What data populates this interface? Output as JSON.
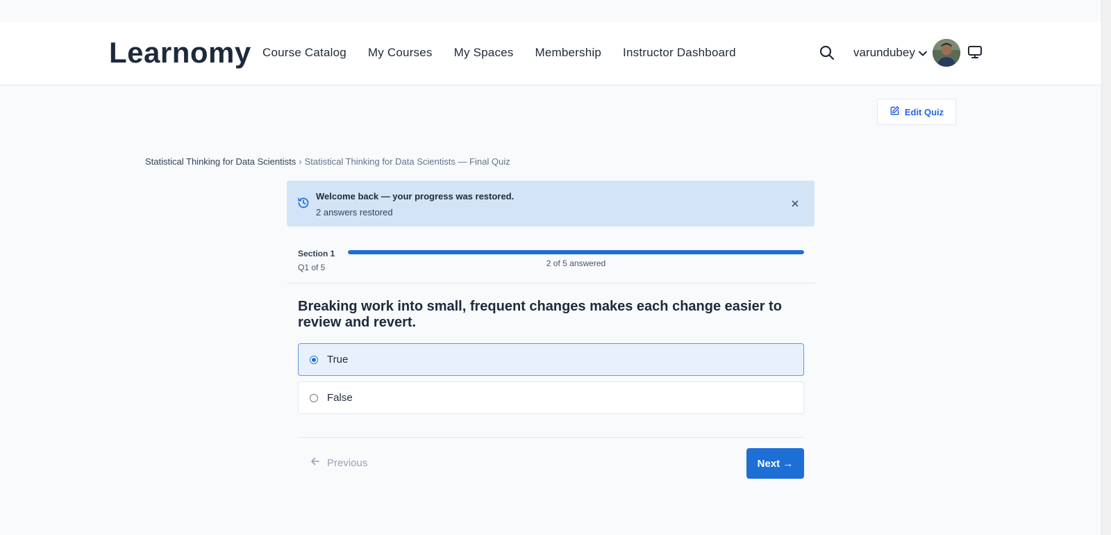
{
  "header": {
    "logo": "Learnomy",
    "nav": [
      "Course Catalog",
      "My Courses",
      "My Spaces",
      "Membership",
      "Instructor Dashboard"
    ],
    "username": "varundubey"
  },
  "toolbar": {
    "edit_quiz_label": "Edit Quiz"
  },
  "breadcrumb": {
    "course": "Statistical Thinking for Data Scientists",
    "separator": "›",
    "current": "Statistical Thinking for Data Scientists — Final Quiz"
  },
  "alert": {
    "title": "Welcome back — your progress was restored.",
    "detail": "2 answers restored"
  },
  "progress": {
    "section": "Section 1",
    "question_position": "Q1 of 5",
    "answered_text": "2 of 5 answered",
    "fill_fraction": 1.0
  },
  "question": {
    "text": "Breaking work into small, frequent changes makes each change easier to review and revert.",
    "options": [
      {
        "label": "True",
        "selected": true
      },
      {
        "label": "False",
        "selected": false
      }
    ]
  },
  "navigation": {
    "previous_label": "Previous",
    "next_label": "Next →"
  },
  "colors": {
    "accent": "#1d6fd6",
    "alert_bg": "#d3e4f6",
    "selected_option_bg": "#e8f1fb"
  }
}
